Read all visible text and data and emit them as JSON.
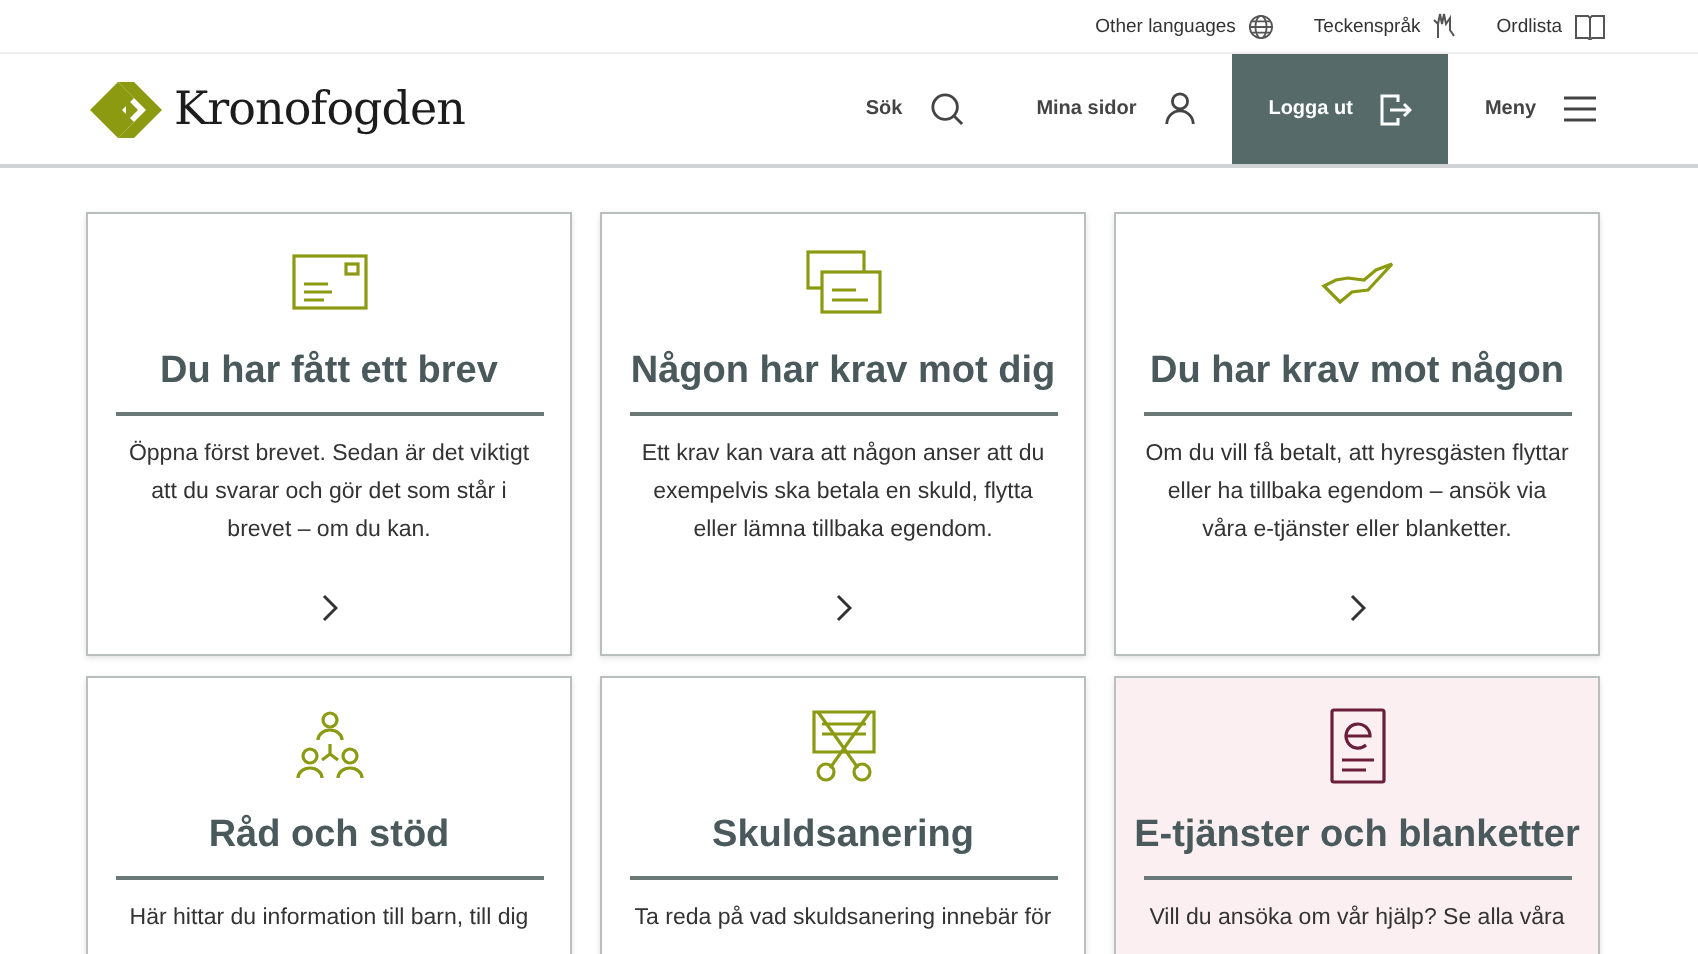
{
  "top_links": [
    {
      "label": "Other languages"
    },
    {
      "label": "Teckenspråk"
    },
    {
      "label": "Ordlista"
    }
  ],
  "logo": {
    "text": "Kronofogden"
  },
  "nav": [
    {
      "label": "Sök",
      "kind": "plain"
    },
    {
      "label": "Mina sidor",
      "kind": "plain"
    },
    {
      "label": "Logga ut",
      "kind": "dark"
    },
    {
      "label": "Meny",
      "kind": "plain"
    }
  ],
  "cards": [
    {
      "kind": "default",
      "title": "Du har fått ett brev",
      "text": "Öppna först brevet. Sedan är det viktigt att du svarar och gör det som står i brevet – om du kan."
    },
    {
      "kind": "default",
      "title": "Någon har krav mot dig",
      "text": "Ett krav kan vara att någon anser att du exempelvis ska betala en skuld, flytta eller lämna tillbaka egendom."
    },
    {
      "kind": "default",
      "title": "Du har krav mot någon",
      "text": "Om du vill få betalt, att hyresgästen flyttar eller ha tillbaka egendom – ansök via våra e-tjänster eller blanketter."
    },
    {
      "kind": "default",
      "title": "Råd och stöd",
      "text": "Här hittar du information till barn, till dig"
    },
    {
      "kind": "default",
      "title": "Skuldsanering",
      "text": "Ta reda på vad skuldsanering innebär för"
    },
    {
      "kind": "highlight",
      "title": "E-tjänster och blanketter",
      "text": "Vill du ansöka om vår hjälp? Se alla våra"
    }
  ]
}
